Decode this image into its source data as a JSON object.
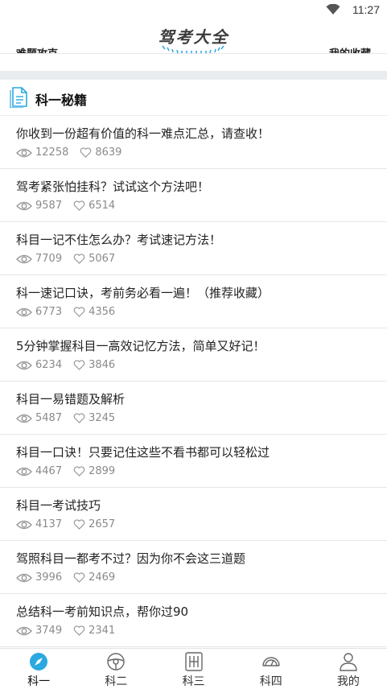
{
  "status": {
    "time": "11:27"
  },
  "header": {
    "title": "驾考大全",
    "peek_left": "难题攻克",
    "peek_right": "我的收藏"
  },
  "section": {
    "title": "科一秘籍"
  },
  "items": [
    {
      "title": "你收到一份超有价值的科一难点汇总，请查收！",
      "views": "12258",
      "likes": "8639"
    },
    {
      "title": "驾考紧张怕挂科？试试这个方法吧！",
      "views": "9587",
      "likes": "6514"
    },
    {
      "title": "科目一记不住怎么办？考试速记方法！",
      "views": "7709",
      "likes": "5067"
    },
    {
      "title": "科一速记口诀，考前务必看一遍！（推荐收藏）",
      "views": "6773",
      "likes": "4356"
    },
    {
      "title": "5分钟掌握科目一高效记忆方法，简单又好记！",
      "views": "6234",
      "likes": "3846"
    },
    {
      "title": "科目一易错题及解析",
      "views": "5487",
      "likes": "3245"
    },
    {
      "title": "科目一口诀！只要记住这些不看书都可以轻松过",
      "views": "4467",
      "likes": "2899"
    },
    {
      "title": "科目一考试技巧",
      "views": "4137",
      "likes": "2657"
    },
    {
      "title": "驾照科目一都考不过？因为你不会这三道题",
      "views": "3996",
      "likes": "2469"
    },
    {
      "title": "总结科一考前知识点，帮你过90",
      "views": "3749",
      "likes": "2341"
    }
  ],
  "tabs": [
    {
      "label": "科一",
      "icon": "compass-icon",
      "active": true
    },
    {
      "label": "科二",
      "icon": "steering-wheel-icon",
      "active": false
    },
    {
      "label": "科三",
      "icon": "gear-shift-icon",
      "active": false
    },
    {
      "label": "科四",
      "icon": "speedometer-icon",
      "active": false
    },
    {
      "label": "我的",
      "icon": "user-icon",
      "active": false
    }
  ],
  "colors": {
    "accent": "#2aa8e0",
    "gray_text": "#8a8a8a",
    "divider": "#e6e6e6",
    "band": "#e9ecef"
  }
}
